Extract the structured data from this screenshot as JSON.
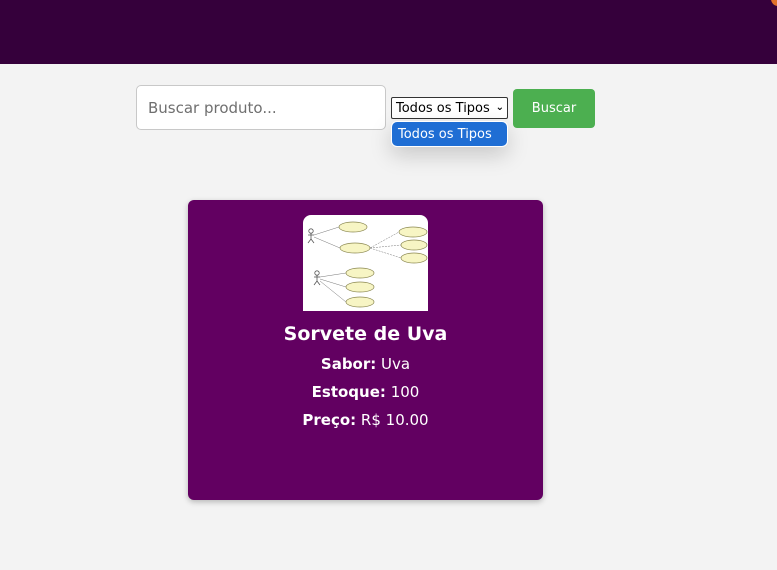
{
  "search": {
    "placeholder": "Buscar produto...",
    "value": ""
  },
  "filter": {
    "selected": "Todos os Tipos",
    "options": [
      "Todos os Tipos"
    ]
  },
  "buttons": {
    "search_label": "Buscar"
  },
  "product": {
    "name": "Sorvete de Uva",
    "flavor_label": "Sabor:",
    "flavor": "Uva",
    "stock_label": "Estoque:",
    "stock": "100",
    "price_label": "Preço:",
    "price": "R$ 10.00",
    "image_icon": "use-case-diagram-thumbnail"
  },
  "colors": {
    "header": "#35003b",
    "card": "#620061",
    "button": "#4caf50",
    "selected_option": "#1f6ed4",
    "background": "#f3f3f3"
  }
}
